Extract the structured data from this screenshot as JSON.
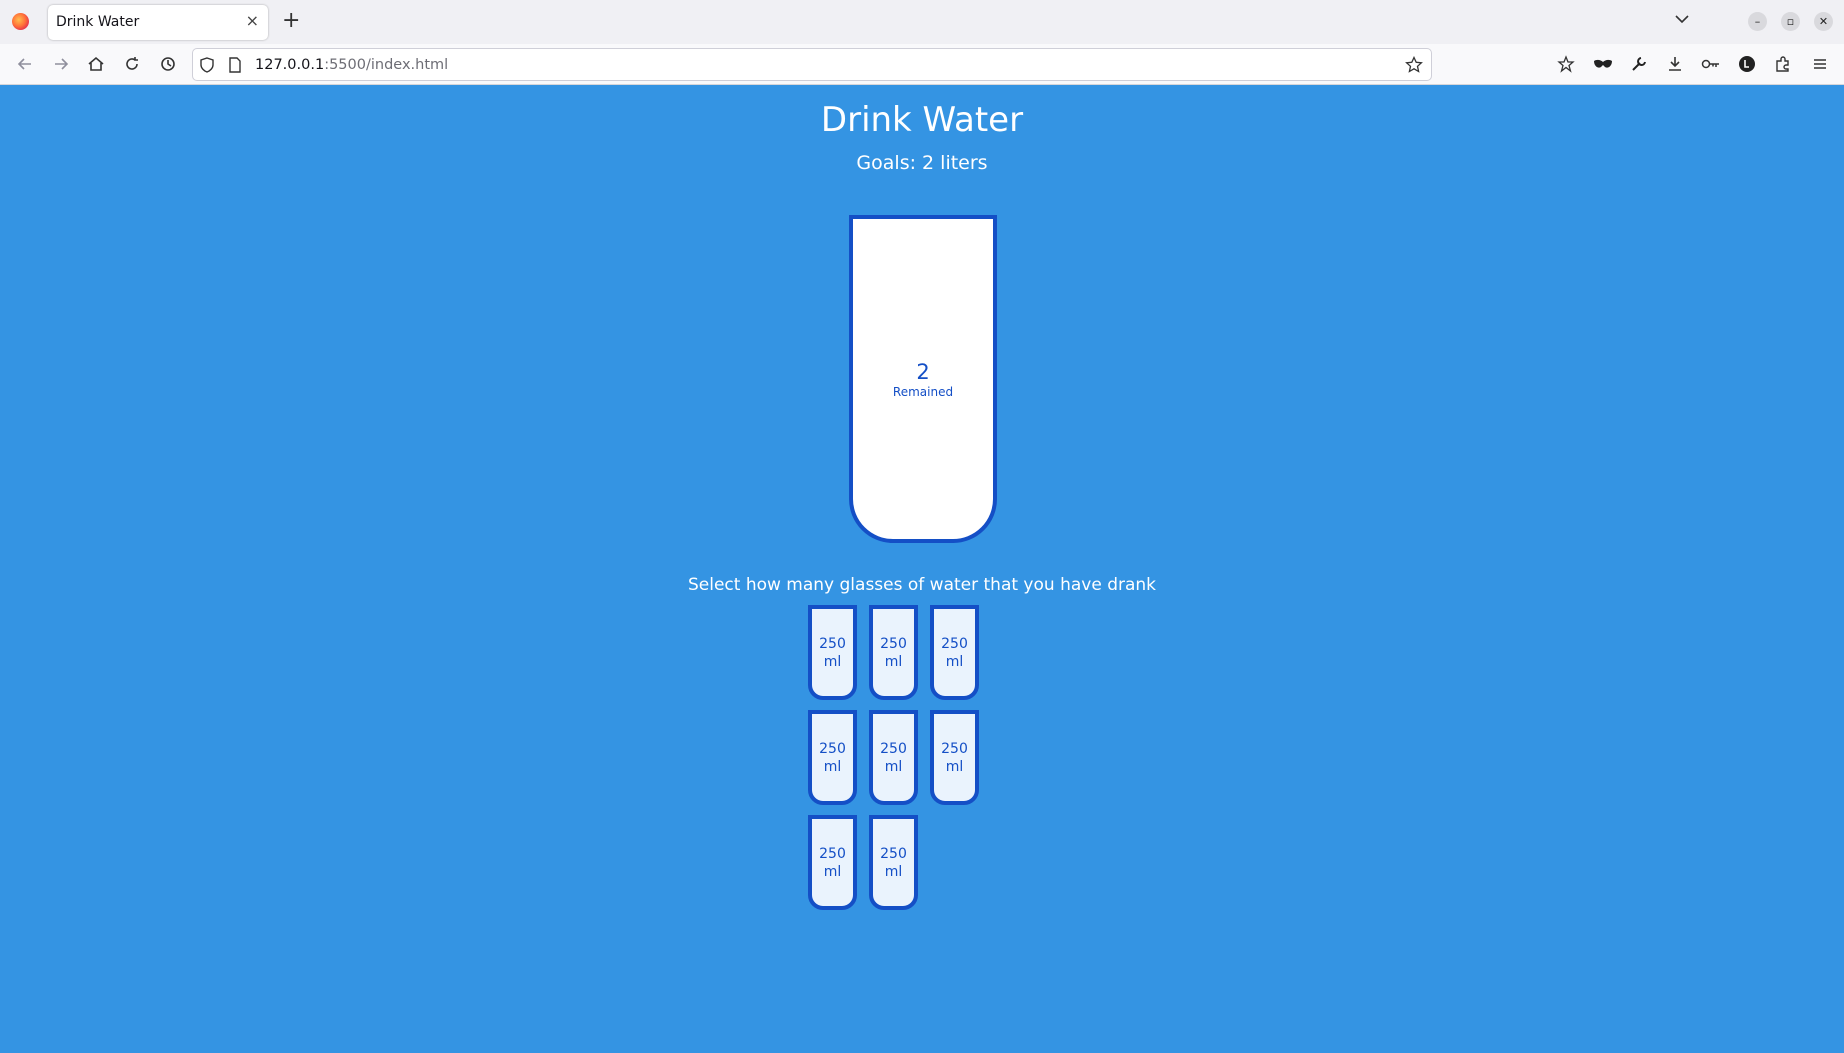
{
  "browser": {
    "tab_title": "Drink Water",
    "tab_close": "×",
    "new_tab": "+",
    "url_host": "127.0.0.1",
    "url_rest": ":5500/index.html"
  },
  "page": {
    "title": "Drink Water",
    "goal": "Goals: 2 liters",
    "remained_liters": "2",
    "remained_label": "Remained",
    "instruction": "Select how many glasses of water that you have drank",
    "cups": [
      {
        "amount": "250",
        "unit": "ml"
      },
      {
        "amount": "250",
        "unit": "ml"
      },
      {
        "amount": "250",
        "unit": "ml"
      },
      {
        "amount": "250",
        "unit": "ml"
      },
      {
        "amount": "250",
        "unit": "ml"
      },
      {
        "amount": "250",
        "unit": "ml"
      },
      {
        "amount": "250",
        "unit": "ml"
      },
      {
        "amount": "250",
        "unit": "ml"
      }
    ]
  },
  "colors": {
    "background": "#3494e3",
    "cup_border": "#144fc6",
    "cup_fill": "#ffffff"
  }
}
